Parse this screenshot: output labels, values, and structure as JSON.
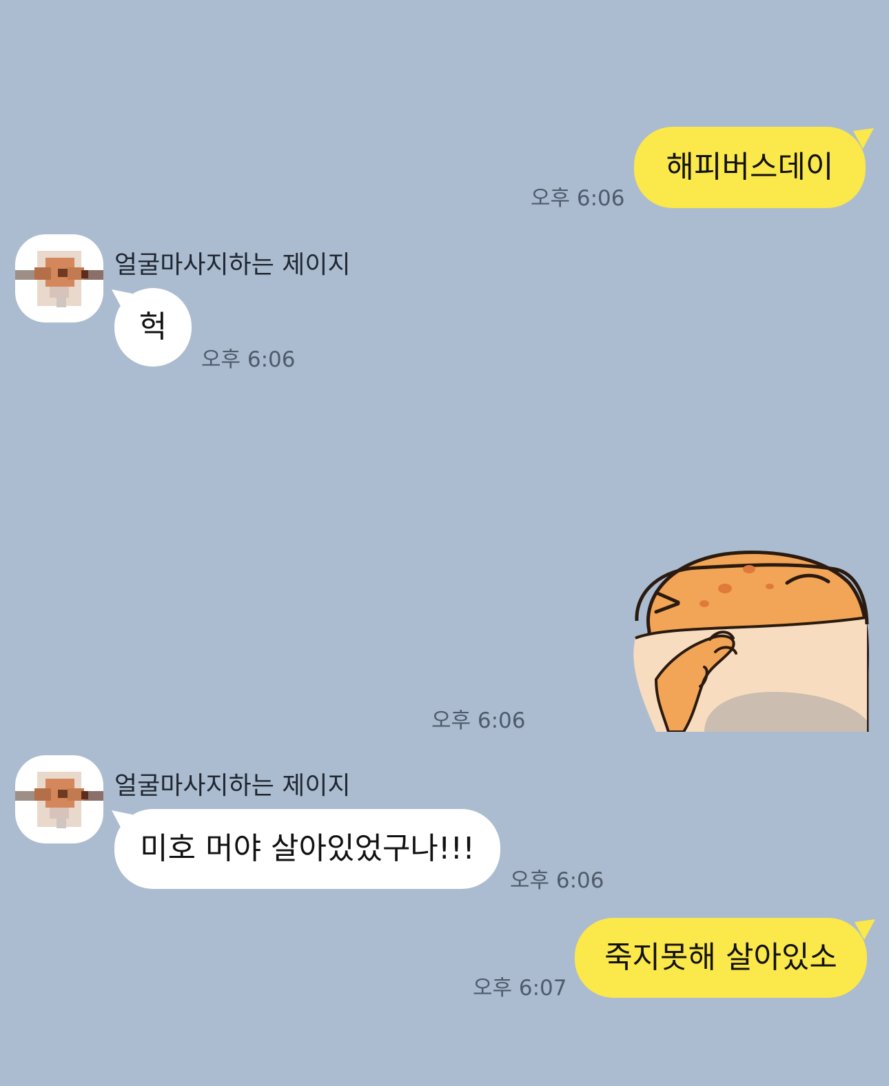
{
  "chat": {
    "messages": [
      {
        "sender": "me",
        "type": "text",
        "text": "해피버스데이",
        "time": "오후 6:06"
      },
      {
        "sender": "them",
        "type": "text",
        "name": "얼굴마사지하는 제이지",
        "text": "헉",
        "time": "오후 6:06"
      },
      {
        "sender": "me",
        "type": "sticker",
        "sticker": "gecko-covering-mouth-sticker",
        "time": "오후 6:06"
      },
      {
        "sender": "them",
        "type": "text",
        "name": "얼굴마사지하는 제이지",
        "text": "미호 머야 살아있었구나!!!",
        "time": "오후 6:06"
      },
      {
        "sender": "me",
        "type": "text",
        "text": "죽지못해 살아있소",
        "time": "오후 6:07"
      }
    ]
  },
  "colors": {
    "background": "#abbcd0",
    "my_bubble": "#fbe84a",
    "their_bubble": "#ffffff",
    "timestamp": "#4e5b6b"
  }
}
